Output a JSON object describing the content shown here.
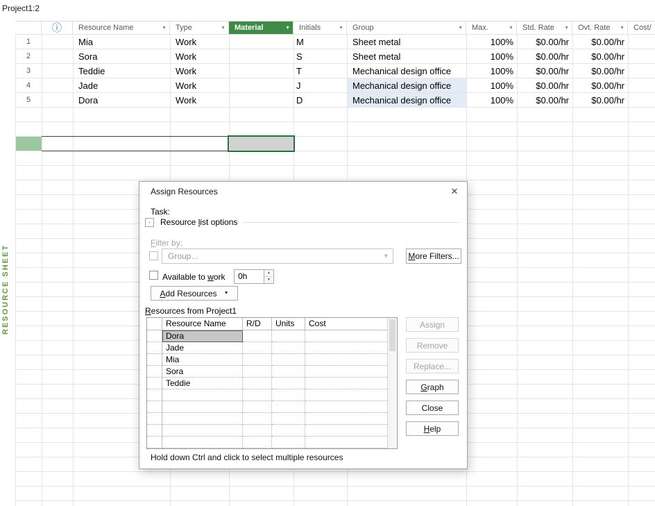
{
  "window": {
    "pane_title": "Project1:2",
    "view_label": "RESOURCE SHEET"
  },
  "icons": {
    "info": "ⓘ",
    "dropdown": "▼",
    "combo_arrow": "▾",
    "close": "✕",
    "spin_up": "▲",
    "spin_down": "▼",
    "expander": "-"
  },
  "colors": {
    "selected_column_header": "#3E8A47",
    "selection_border": "#217346",
    "selected_row_header": "#9DC79F",
    "row_highlight": "#E2EBF6",
    "view_label_green": "#5F9B41"
  },
  "sheet": {
    "columns": {
      "resource_name": "Resource Name",
      "type": "Type",
      "material": "Material",
      "initials": "Initials",
      "group": "Group",
      "max": "Max.",
      "std_rate": "Std. Rate",
      "ovt_rate": "Ovt. Rate",
      "cost": "Cost/"
    },
    "rows": [
      {
        "num": "1",
        "name": "Mia",
        "type": "Work",
        "initials": "M",
        "group": "Sheet metal",
        "max": "100%",
        "std_rate": "$0.00/hr",
        "ovt_rate": "$0.00/hr"
      },
      {
        "num": "2",
        "name": "Sora",
        "type": "Work",
        "initials": "S",
        "group": "Sheet metal",
        "max": "100%",
        "std_rate": "$0.00/hr",
        "ovt_rate": "$0.00/hr"
      },
      {
        "num": "3",
        "name": "Teddie",
        "type": "Work",
        "initials": "T",
        "group": "Mechanical design office",
        "max": "100%",
        "std_rate": "$0.00/hr",
        "ovt_rate": "$0.00/hr"
      },
      {
        "num": "4",
        "name": "Jade",
        "type": "Work",
        "initials": "J",
        "group": "Mechanical design office",
        "max": "100%",
        "std_rate": "$0.00/hr",
        "ovt_rate": "$0.00/hr"
      },
      {
        "num": "5",
        "name": "Dora",
        "type": "Work",
        "initials": "D",
        "group": "Mechanical design office",
        "max": "100%",
        "std_rate": "$0.00/hr",
        "ovt_rate": "$0.00/hr"
      }
    ]
  },
  "dialog": {
    "title": "Assign Resources",
    "task_label": "Task:",
    "resource_list_options": {
      "pre": "Resource ",
      "key": "l",
      "post": "ist options"
    },
    "filter_by": {
      "pre": "",
      "key": "F",
      "post": "ilter by:"
    },
    "group_filter_value": "Group...",
    "more_filters": {
      "pre": "",
      "key": "M",
      "post": "ore Filters..."
    },
    "available_to_work": {
      "pre": "Available to ",
      "key": "w",
      "post": "ork"
    },
    "work_value": "0h",
    "add_resources": {
      "pre": "",
      "key": "A",
      "post": "dd Resources"
    },
    "resources_from": {
      "pre": "",
      "key": "R",
      "post": "esources from Project1"
    },
    "grid": {
      "headers": {
        "name": "Resource Name",
        "rd": "R/D",
        "units": "Units",
        "cost": "Cost"
      },
      "resources": [
        "Dora",
        "Jade",
        "Mia",
        "Sora",
        "Teddie"
      ],
      "selected": "Dora"
    },
    "buttons": {
      "assign": {
        "pre": "Assign",
        "key": "",
        "post": ""
      },
      "remove": {
        "pre": "Remove",
        "key": "",
        "post": ""
      },
      "replace": {
        "pre": "Replace...",
        "key": "",
        "post": ""
      },
      "graph": {
        "pre": "",
        "key": "G",
        "post": "raph"
      },
      "close": {
        "pre": "Close",
        "key": "",
        "post": ""
      },
      "help": {
        "pre": "",
        "key": "H",
        "post": "elp"
      }
    },
    "hint": "Hold down Ctrl and click to select multiple resources"
  }
}
